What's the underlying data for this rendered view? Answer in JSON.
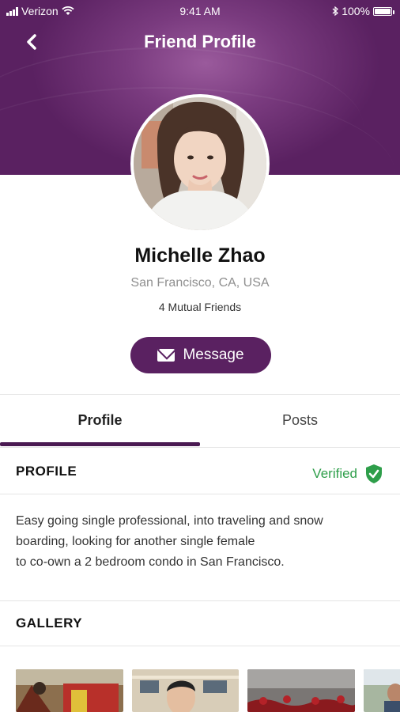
{
  "status_bar": {
    "carrier": "Verizon",
    "time": "9:41 AM",
    "battery": "100%"
  },
  "header": {
    "title": "Friend Profile"
  },
  "profile": {
    "name": "Michelle Zhao",
    "location": "San Francisco, CA, USA",
    "mutual": "4 Mutual Friends",
    "message_label": "Message"
  },
  "tabs": [
    {
      "label": "Profile",
      "active": true
    },
    {
      "label": "Posts",
      "active": false
    }
  ],
  "profile_section": {
    "title": "PROFILE",
    "verified": "Verified",
    "about_lines": [
      "Easy going single professional, into traveling and snow",
      "boarding, looking for another single female",
      "to co-own a 2 bedroom condo in San Francisco."
    ]
  },
  "gallery_section": {
    "title": "GALLERY",
    "items": [
      "gallery-photo-1",
      "gallery-photo-2",
      "gallery-photo-3",
      "gallery-photo-4"
    ]
  },
  "colors": {
    "brand": "#5a2161",
    "verified": "#2e9e4a"
  }
}
